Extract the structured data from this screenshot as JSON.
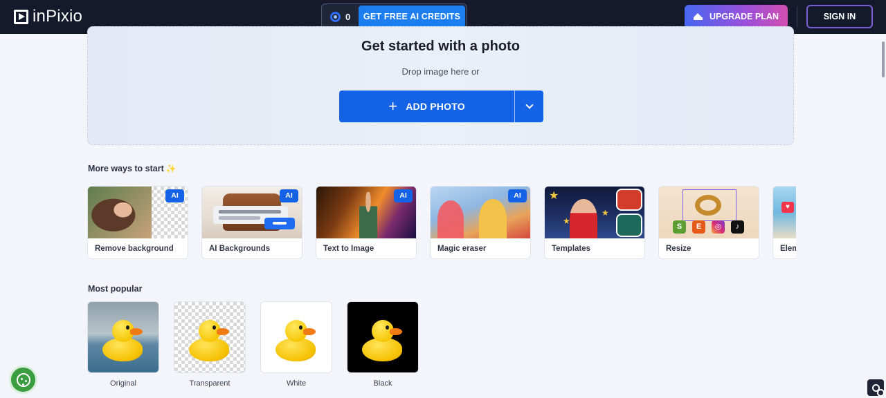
{
  "header": {
    "logo_text": "inPixio",
    "credits_count": "0",
    "free_credits_label": "GET FREE AI CREDITS",
    "upgrade_label": "UPGRADE PLAN",
    "signin_label": "SIGN IN"
  },
  "upload": {
    "title": "Get started with a photo",
    "subtitle": "Drop image here or",
    "add_photo_label": "ADD PHOTO"
  },
  "more_ways": {
    "heading": "More ways to start",
    "cards": [
      {
        "label": "Remove background",
        "badge": "AI"
      },
      {
        "label": "AI Backgrounds",
        "badge": "AI"
      },
      {
        "label": "Text to Image",
        "badge": "AI"
      },
      {
        "label": "Magic eraser",
        "badge": "AI"
      },
      {
        "label": "Templates"
      },
      {
        "label": "Resize"
      },
      {
        "label": "Elements"
      }
    ]
  },
  "most_popular": {
    "heading": "Most popular",
    "items": [
      {
        "label": "Original"
      },
      {
        "label": "Transparent"
      },
      {
        "label": "White"
      },
      {
        "label": "Black"
      }
    ]
  },
  "resize_social": [
    "S",
    "E",
    "◎",
    "♪"
  ],
  "colors": {
    "header_bg": "#141a2b",
    "primary_blue": "#1463e6",
    "credits_blue": "#1c7ef0",
    "upgrade_gradient_start": "#4767f0",
    "upgrade_gradient_end": "#d24fb0",
    "cookie_green": "#3a9d3f"
  }
}
